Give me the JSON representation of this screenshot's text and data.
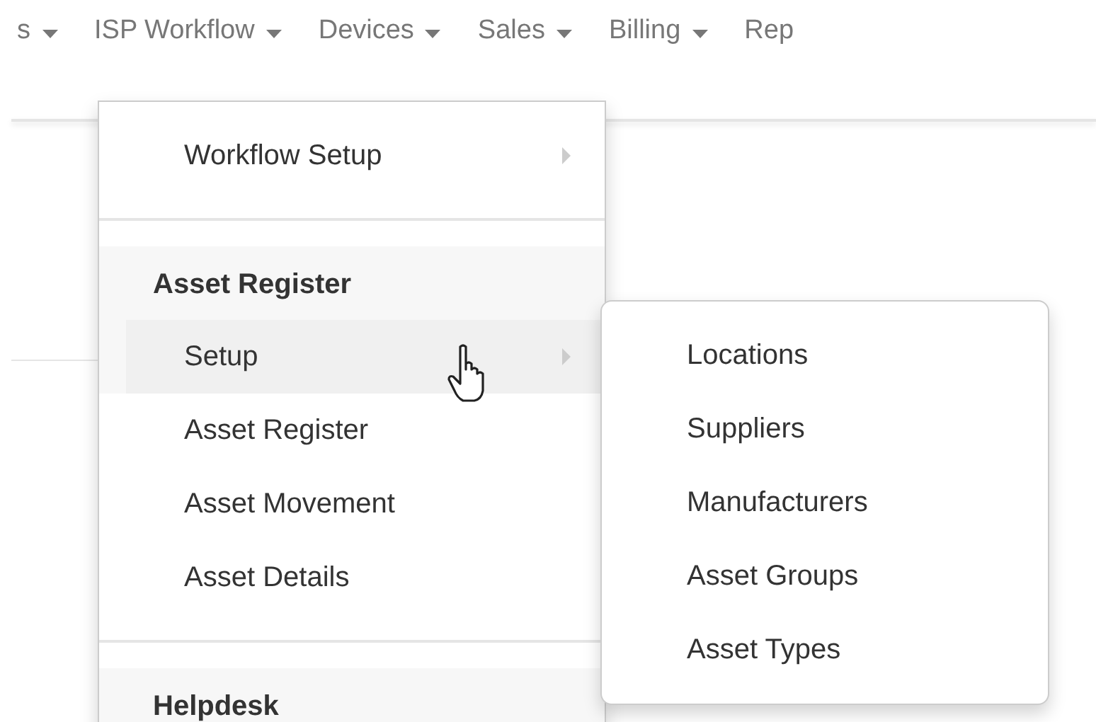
{
  "nav": [
    {
      "label": "s",
      "caret": true
    },
    {
      "label": "ISP Workflow",
      "caret": true
    },
    {
      "label": "Devices",
      "caret": true
    },
    {
      "label": "Sales",
      "caret": true
    },
    {
      "label": "Billing",
      "caret": true
    },
    {
      "label": "Rep",
      "caret": false
    }
  ],
  "menu": [
    {
      "kind": "item",
      "label": "Workflow Setup",
      "submenu": true,
      "selected": false
    },
    {
      "kind": "divider"
    },
    {
      "kind": "header",
      "label": "Asset Register"
    },
    {
      "kind": "item",
      "label": "Setup",
      "submenu": true,
      "selected": true
    },
    {
      "kind": "item",
      "label": "Asset Register",
      "submenu": false,
      "selected": false
    },
    {
      "kind": "item",
      "label": "Asset Movement",
      "submenu": false,
      "selected": false
    },
    {
      "kind": "item",
      "label": "Asset Details",
      "submenu": false,
      "selected": false
    },
    {
      "kind": "divider"
    },
    {
      "kind": "header",
      "label": "Helpdesk"
    }
  ],
  "submenu": [
    {
      "label": "Locations"
    },
    {
      "label": "Suppliers"
    },
    {
      "label": "Manufacturers"
    },
    {
      "label": "Asset Groups"
    },
    {
      "label": "Asset Types"
    }
  ]
}
